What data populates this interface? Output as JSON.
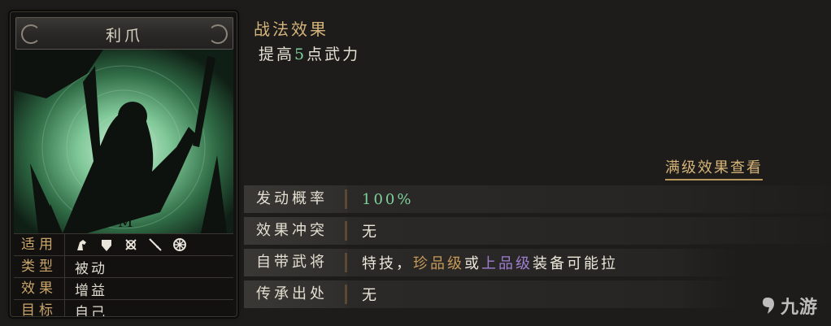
{
  "card": {
    "name": "利爪",
    "info": [
      {
        "key": "适用",
        "type": "icons",
        "icons": [
          "cavalry-icon",
          "shield-icon",
          "bow-icon",
          "spear-icon",
          "siege-icon"
        ]
      },
      {
        "key": "类型",
        "value": "被动"
      },
      {
        "key": "效果",
        "value": "增益"
      },
      {
        "key": "目标",
        "value": "自己"
      }
    ]
  },
  "effect": {
    "title": "战法效果",
    "text_prefix": "提高",
    "text_highlight": "5",
    "text_suffix": "点武力",
    "full_level_link": "满级效果查看"
  },
  "stats": [
    {
      "key": "发动概率",
      "value": "100%"
    },
    {
      "key": "效果冲突",
      "value": "无"
    },
    {
      "key": "自带武将",
      "value_a": "特技，",
      "value_rare": "珍品级",
      "value_b": "或",
      "value_fine": "上品级",
      "value_c": "装备可能拉"
    },
    {
      "key": "传承出处",
      "value": "无"
    }
  ],
  "watermark": "九游",
  "colors": {
    "accent_gold": "#d4b47a",
    "highlight_green": "#7ed19b",
    "rare_orange": "#c79a57",
    "fine_purple": "#9f7fd2"
  }
}
